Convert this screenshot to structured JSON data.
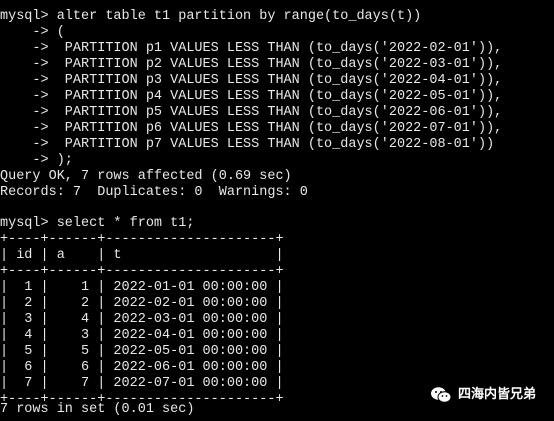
{
  "terminal": {
    "lines": [
      "mysql> alter table t1 partition by range(to_days(t))",
      "    -> (",
      "    ->  PARTITION p1 VALUES LESS THAN (to_days('2022-02-01')),",
      "    ->  PARTITION p2 VALUES LESS THAN (to_days('2022-03-01')),",
      "    ->  PARTITION p3 VALUES LESS THAN (to_days('2022-04-01')),",
      "    ->  PARTITION p4 VALUES LESS THAN (to_days('2022-05-01')),",
      "    ->  PARTITION p5 VALUES LESS THAN (to_days('2022-06-01')),",
      "    ->  PARTITION p6 VALUES LESS THAN (to_days('2022-07-01')),",
      "    ->  PARTITION p7 VALUES LESS THAN (to_days('2022-08-01'))",
      "    -> );",
      "Query OK, 7 rows affected (0.69 sec)",
      "Records: 7  Duplicates: 0  Warnings: 0",
      "",
      "mysql> select * from t1;",
      "+----+------+---------------------+",
      "| id | a    | t                   |",
      "+----+------+---------------------+",
      "|  1 |    1 | 2022-01-01 00:00:00 |",
      "|  2 |    2 | 2022-02-01 00:00:00 |",
      "|  3 |    4 | 2022-03-01 00:00:00 |",
      "|  4 |    3 | 2022-04-01 00:00:00 |",
      "|  5 |    5 | 2022-05-01 00:00:00 |",
      "|  6 |    6 | 2022-06-01 00:00:00 |",
      "|  7 |    7 | 2022-07-01 00:00:00 |",
      "+----+------+---------------------+",
      "7 rows in set (0.01 sec)"
    ]
  },
  "watermark": {
    "icon": "wechat-icon",
    "text": "四海内皆兄弟"
  },
  "colors": {
    "background": "#000000",
    "text": "#e8e8e8"
  }
}
